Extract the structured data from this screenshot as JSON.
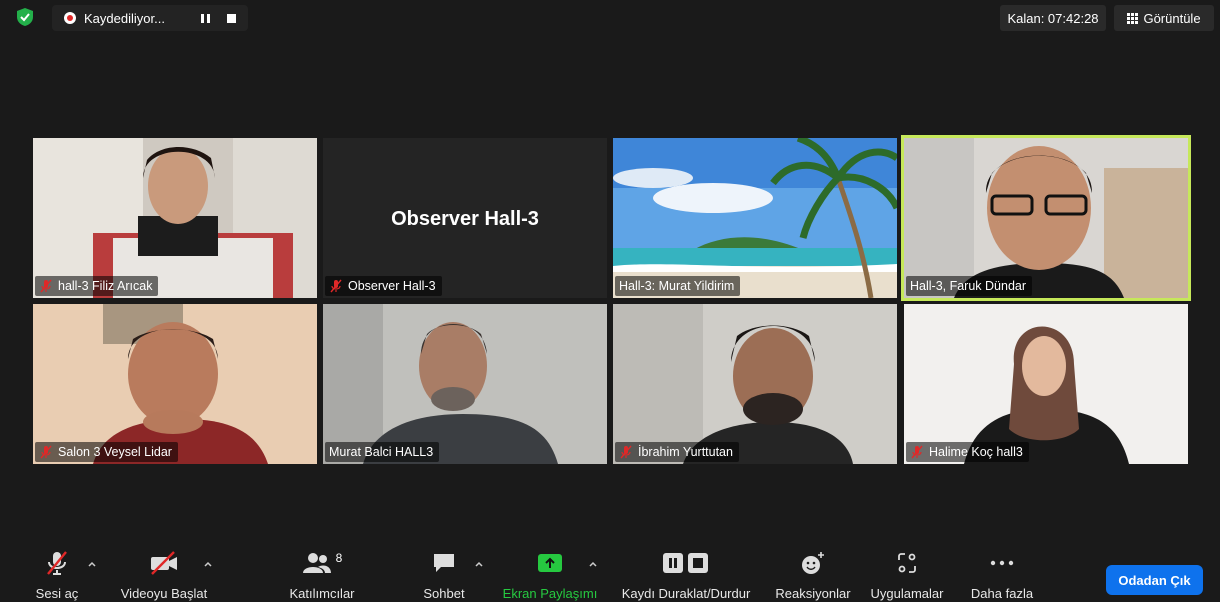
{
  "topbar": {
    "recording_label": "Kaydediliyor...",
    "timer": "Kalan: 07:42:28",
    "view_label": "Görüntüle"
  },
  "tiles": [
    {
      "name": "hall-3 Filiz Arıcak",
      "muted": true
    },
    {
      "name": "Observer Hall-3",
      "muted": true,
      "title": "Observer Hall-3"
    },
    {
      "name": "Hall-3: Murat Yildirim",
      "muted": false
    },
    {
      "name": "Hall-3, Faruk Dündar",
      "muted": false,
      "active": true
    },
    {
      "name": "Salon 3 Veysel Lidar",
      "muted": true
    },
    {
      "name": "Murat Balci HALL3",
      "muted": false
    },
    {
      "name": "İbrahim Yurttutan",
      "muted": true
    },
    {
      "name": "Halime Koç hall3",
      "muted": true
    }
  ],
  "toolbar": {
    "audio": "Sesi aç",
    "video": "Videoyu Başlat",
    "participants": "Katılımcılar",
    "participants_count": "8",
    "chat": "Sohbet",
    "share": "Ekran Paylaşımı",
    "record": "Kaydı Duraklat/Durdur",
    "reactions": "Reaksiyonlar",
    "apps": "Uygulamalar",
    "more": "Daha fazla",
    "leave": "Odadan Çık"
  },
  "colors": {
    "background": "#1a1a1a",
    "active_speaker": "#c6e85a",
    "share_green": "#26c940",
    "leave_blue": "#0e72ed",
    "mute_red": "#e02828"
  }
}
